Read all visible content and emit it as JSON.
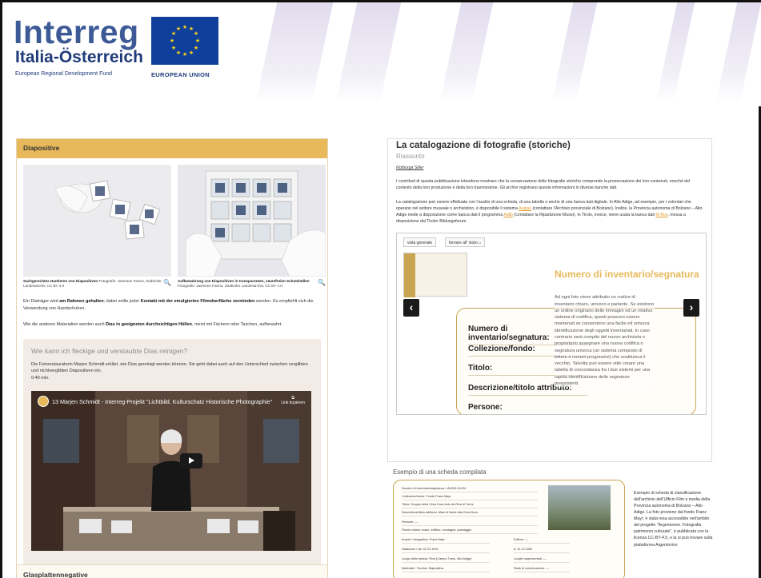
{
  "header": {
    "logo_word": "Interreg",
    "logo_sub": "Italia-Österreich",
    "fund": "European Regional Development Fund",
    "eu_label": "EUROPEAN UNION",
    "brand_color": "#3d5a97"
  },
  "left": {
    "section_title": "Diapositive",
    "photos": [
      {
        "caption_bold": "Sachgerechtes Hantieren von Diapositiven",
        "caption_rest": " Fotografie: Jasmeen Farina, Südtiroler Landesarchiv, CC BY 4.0"
      },
      {
        "caption_bold": "Aufbewahrung von Diapositiven in transparenten, säurefreien Schutzhüllen",
        "caption_rest": " Fotografie: Jasmeen Farina, Südtiroler Landesarchiv, CC BY 4.0"
      }
    ],
    "para1_a": "Ein Diaträger wird ",
    "para1_b": "am Rahmen gehalten",
    "para1_c": "; dabei sollte jeder ",
    "para1_d": "Kontakt mit der emulgierten Filmoberfläche vermieden",
    "para1_e": " werden. Es empfiehlt sich die Verwendung von Handschuhen.",
    "para2_a": "Wie die anderen Materialien werden auch ",
    "para2_b": "Dias in geeigneten durchsichtigen Hüllen",
    "para2_c": ", meist mit Fächern oder Taschen, aufbewahrt.",
    "box_title": "Wie kann ich fleckige und verstaubte Dias reinigen?",
    "box_text": "Die Fotorestauratorin Marjen Schmidt erklärt, wie Dias gereinigt werden können. Sie geht dabei auch auf den Unterschied zwischen vergilbten und nichtvergilbten Diapositiven ein.",
    "duration": "0:49 min.",
    "video_title": "13 Marjen Schmidt - Interreg-Projekt \"Lichtbild. Kulturschatz Historische Photographie\"",
    "video_copy": "Link kopieren",
    "next_section": "Glasplattennegative"
  },
  "right": {
    "title": "La catalogazione di fotografie (storiche)",
    "subtitle": "Riassunto",
    "author": "Notburga Siller",
    "p1": "I contributi di questa pubblicazione intendono mostrare che la conservazione delle fotografie storiche comprende la preservazione dei loro contenuti, nonché del contesto della loro produzione e della loro trasmissione. Gli archivi registrano queste informazioni in diverse banche dati.",
    "p2_a": "La catalogazione può essere effettuata con l'ausilio di una scheda, di una tabella o anche di una banca dati digitale. In Alto Adige, ad esempio, per i volontari che operano nel settore museale o archivistico, è disponibile il sistema ",
    "p2_link1": "Augias",
    "p2_b": " (contattare l'Archivio provinciale di Bolzano). Inoltre, la Provincia autonoma di Bolzano – Alto Adige mette a disposizione come banca dati il programma ",
    "p2_link2": "Adlib",
    "p2_c": " (contattare la Ripartizione Musei). In Tirolo, invece, viene usata la banca dati ",
    "p2_link3": "M-Box",
    "p2_d": ", messa a disposizione dal Tiroler Bildungsforum.",
    "slider": {
      "tab1": "vista generale",
      "tab2": "tornare all' inizio",
      "heading": "Numero di inventario/segnatura",
      "desc": "Ad ogni foto viene attribuito un codice di inventario chiaro, univoco e parlante. Se esistono un ordine originario delle immagini ed un relativo sistema di codifica, questi possono essere mantenuti se consentono una facile ed univoca identificazione degli oggetti inventariati. In caso contrario sarà compito del nuovo archivista o proprietario assegnare una nuova codifica o segnatura univoca (un sistema composto di lettere e numeri progressivi) che sostituisca il vecchio. Talvolta può essere utile creare una tabella di concordanza fra i due sistemi per una rapida identificazione delle segnature preesistenti.",
      "fields": [
        "Numero di inventario/segnatura:",
        "Collezione/fondo:",
        "Titolo:",
        "Descrizione/titolo attributo:",
        "Persone:"
      ],
      "prev": "‹",
      "next": "›"
    },
    "example_title": "Esempio di una scheda compilata",
    "example_rows": [
      "Numero di inventario/segnatura: LAV329-01024",
      "Collezione/fondo: Fondo Franz Mayr",
      "Titolo: Gruppo della Cima Dura visto da Riva di Tures",
      "Descrizione/titolo attributo: Masi di fronte alla Cima Dura",
      "Persone: —",
      "Parole chiave: maso, edificio, montagna, paesaggio",
      "Autore / fotografo/a: Franz Mayr",
      "Datazione / da: 01.01.1902",
      "Luogo della ripresa: Riva (Campo Tures, Alto Adige)",
      "Materiale / Tecnica: Diapositiva"
    ],
    "example_rows_right": [
      "Editore: —",
      "a: 31.12.1902",
      "Luoghi rappresentati: —",
      "Stato di conservazione: —"
    ],
    "example_side": "Esempio di scheda di classificazione dell'archivio dell'Ufficio Film e media della Provincia autonoma di Bolzano – Alto Adige. La foto proviene dal fondo Franz Mayr; è stata resa accessibile nell'ambito del progetto \"Argentovivo. Fotografia patrimonio culturale\", è pubblicata con la licenza CC-BY-4.5, e la si può trovare sulla piattaforma Argentovivo"
  }
}
